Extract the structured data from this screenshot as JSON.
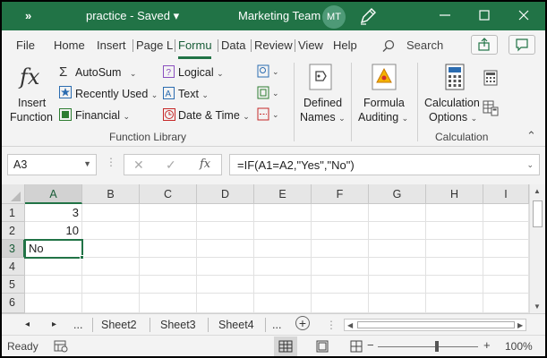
{
  "titlebar": {
    "quick_access": "»",
    "filename": "practice - Saved",
    "filename_caret": "▾",
    "team": "Marketing Team",
    "avatar_initials": "MT",
    "bg_color": "#217346"
  },
  "tabs": [
    "File",
    "Home",
    "Insert",
    "Page L",
    "Formu",
    "Data",
    "Review",
    "View",
    "Help"
  ],
  "active_tab": "Formu",
  "search": {
    "label": "Search"
  },
  "ribbon": {
    "insert_function_top": "Insert",
    "insert_function_bottom": "Function",
    "autosum": "AutoSum",
    "recently_used": "Recently Used",
    "financial": "Financial",
    "logical": "Logical",
    "text": "Text",
    "date_time": "Date & Time",
    "function_library_label": "Function Library",
    "defined_names_top": "Defined",
    "defined_names_bottom": "Names",
    "formula_auditing_top": "Formula",
    "formula_auditing_bottom": "Auditing",
    "calc_options_top": "Calculation",
    "calc_options_bottom": "Options",
    "calculation_label": "Calculation",
    "collapse": "⌃"
  },
  "formula_bar": {
    "name_box": "A3",
    "cancel": "✕",
    "enter": "✓",
    "fx": "fx",
    "formula": "=IF(A1=A2,\"Yes\",\"No\")"
  },
  "grid": {
    "columns": [
      "A",
      "B",
      "C",
      "D",
      "E",
      "F",
      "G",
      "H",
      "I"
    ],
    "rows": [
      "1",
      "2",
      "3",
      "4",
      "5",
      "6"
    ],
    "cells": {
      "A1": "3",
      "A2": "10",
      "A3": "No"
    }
  },
  "sheets": {
    "prev": "◂",
    "next": "▸",
    "more_left": "...",
    "tabs": [
      "Sheet2",
      "Sheet3",
      "Sheet4"
    ],
    "more_right": "...",
    "add": "+"
  },
  "status": {
    "ready": "Ready",
    "zoom_minus": "−",
    "zoom_plus": "+",
    "zoom": "100%"
  }
}
